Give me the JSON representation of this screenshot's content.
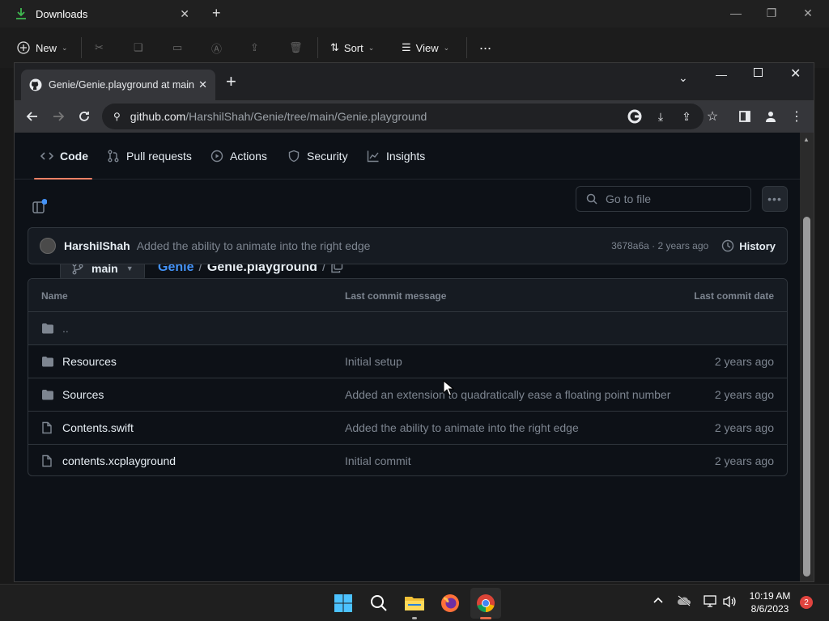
{
  "explorer": {
    "title": "Downloads",
    "toolbar": {
      "new_label": "New",
      "sort_label": "Sort",
      "view_label": "View",
      "more_label": "..."
    }
  },
  "browser": {
    "tab_title": "Genie/Genie.playground at main",
    "url_host": "github.com",
    "url_path": "/HarshilShah/Genie/tree/main/Genie.playground"
  },
  "repo_nav": {
    "items": [
      {
        "label": "Code",
        "icon": "code-icon"
      },
      {
        "label": "Pull requests",
        "icon": "pull-request-icon"
      },
      {
        "label": "Actions",
        "icon": "actions-icon"
      },
      {
        "label": "Security",
        "icon": "shield-icon"
      },
      {
        "label": "Insights",
        "icon": "graph-icon"
      }
    ]
  },
  "path_bar": {
    "branch": "main",
    "repo": "Genie",
    "sep1": "/",
    "folder": "Genie.playground",
    "sep2": "/",
    "search_placeholder": "Go to file"
  },
  "commit": {
    "author": "HarshilShah",
    "message": "Added the ability to animate into the right edge",
    "meta": "3678a6a · 2 years ago",
    "history_label": "History"
  },
  "files": {
    "headers": {
      "name": "Name",
      "message": "Last commit message",
      "date": "Last commit date"
    },
    "parent": "..",
    "rows": [
      {
        "type": "folder",
        "name": "Resources",
        "message": "Initial setup",
        "date": "2 years ago"
      },
      {
        "type": "folder",
        "name": "Sources",
        "message": "Added an extension to quadratically ease a floating point number",
        "date": "2 years ago"
      },
      {
        "type": "file",
        "name": "Contents.swift",
        "message": "Added the ability to animate into the right edge",
        "date": "2 years ago"
      },
      {
        "type": "file",
        "name": "contents.xcplayground",
        "message": "Initial commit",
        "date": "2 years ago"
      }
    ]
  },
  "taskbar": {
    "time": "10:19 AM",
    "date": "8/6/2023",
    "notification_count": "2"
  },
  "colors": {
    "accent_underline": "#f78166",
    "link": "#4493f8",
    "bg": "#0d1117"
  }
}
